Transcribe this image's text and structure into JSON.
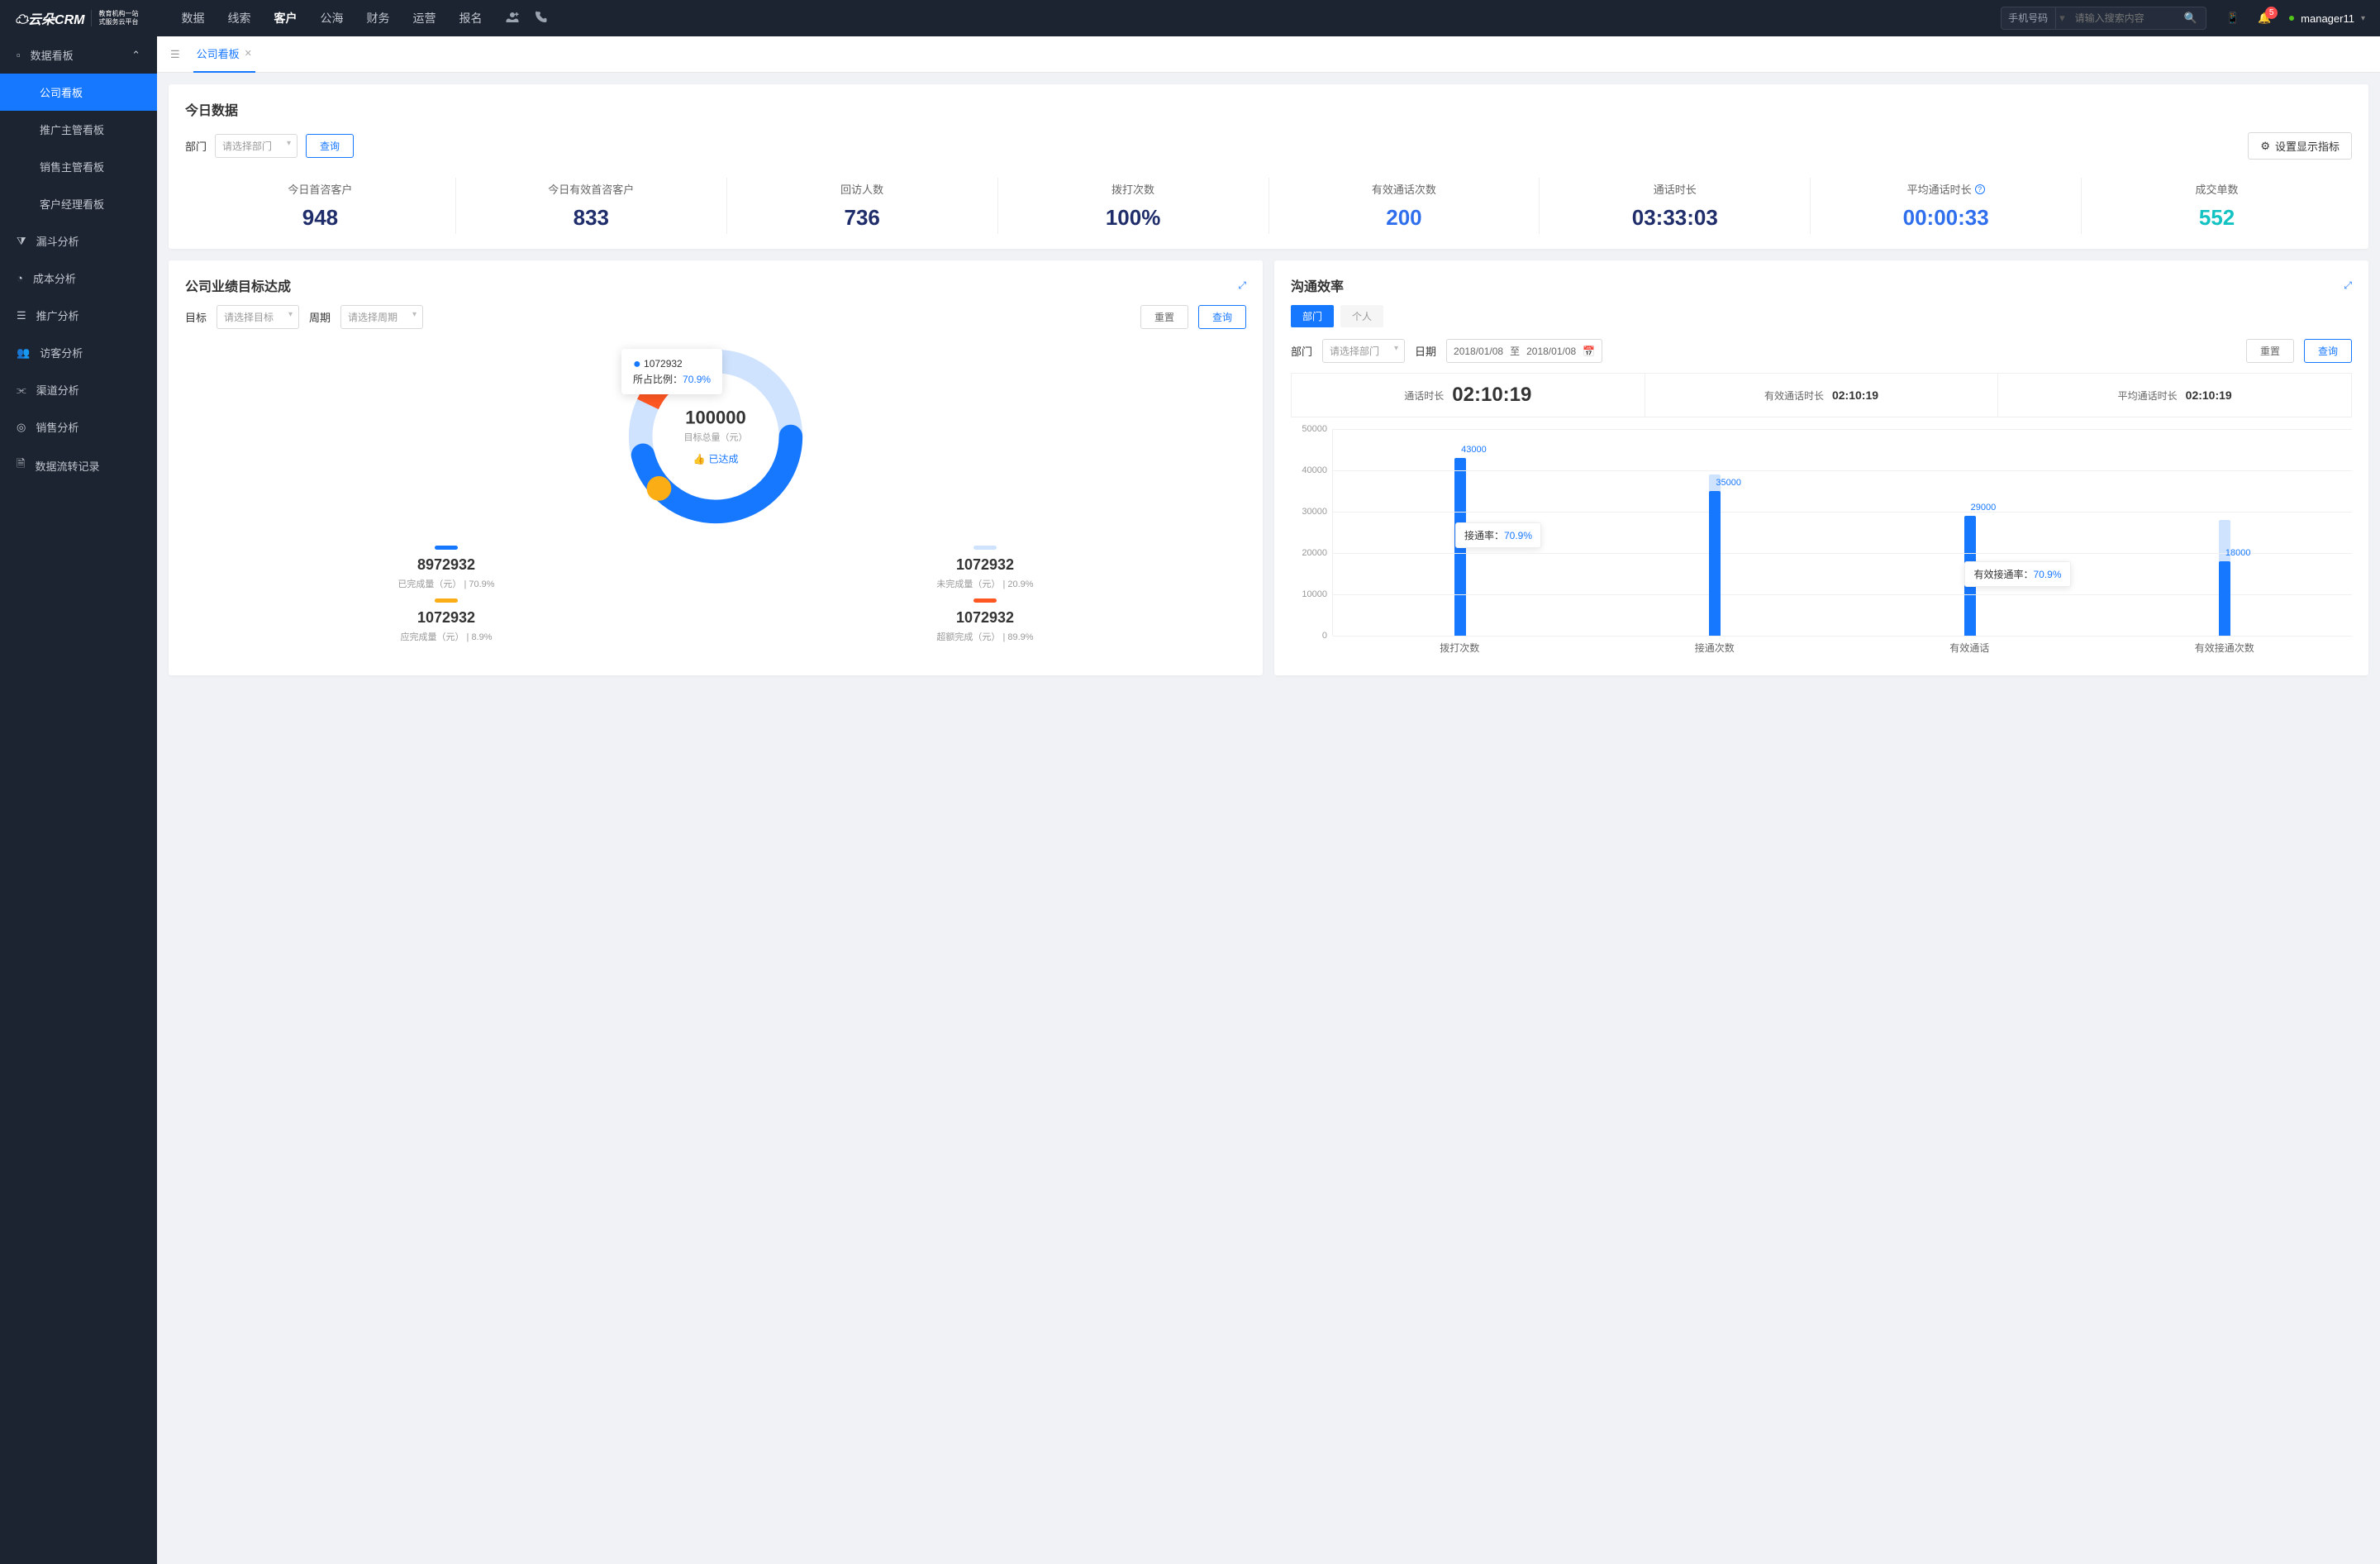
{
  "brand": {
    "name": "云朵CRM",
    "url": "www.yunduocrm.com",
    "tagline1": "教育机构一站",
    "tagline2": "式服务云平台"
  },
  "topnav": {
    "links": [
      "数据",
      "线索",
      "客户",
      "公海",
      "财务",
      "运营",
      "报名"
    ],
    "active": "客户",
    "search_type": "手机号码",
    "search_placeholder": "请输入搜索内容",
    "badge": "5",
    "user": "manager11"
  },
  "sidebar": {
    "group": {
      "label": "数据看板",
      "expanded": true
    },
    "subs": [
      "公司看板",
      "推广主管看板",
      "销售主管看板",
      "客户经理看板"
    ],
    "active_sub": "公司看板",
    "items": [
      "漏斗分析",
      "成本分析",
      "推广分析",
      "访客分析",
      "渠道分析",
      "销售分析",
      "数据流转记录"
    ]
  },
  "tabs": {
    "active": "公司看板"
  },
  "today": {
    "title": "今日数据",
    "dept_label": "部门",
    "dept_placeholder": "请选择部门",
    "query": "查询",
    "config": "设置显示指标",
    "metrics": [
      {
        "label": "今日首咨客户",
        "value": "948",
        "color": "navy"
      },
      {
        "label": "今日有效首咨客户",
        "value": "833",
        "color": "navy"
      },
      {
        "label": "回访人数",
        "value": "736",
        "color": "navy"
      },
      {
        "label": "拨打次数",
        "value": "100%",
        "color": "navy"
      },
      {
        "label": "有效通话次数",
        "value": "200",
        "color": "blue"
      },
      {
        "label": "通话时长",
        "value": "03:33:03",
        "color": "navy"
      },
      {
        "label": "平均通话时长",
        "value": "00:00:33",
        "color": "blue",
        "info": true
      },
      {
        "label": "成交单数",
        "value": "552",
        "color": "cyan"
      }
    ]
  },
  "goal": {
    "title": "公司业绩目标达成",
    "target_label": "目标",
    "target_placeholder": "请选择目标",
    "period_label": "周期",
    "period_placeholder": "请选择周期",
    "reset": "重置",
    "query": "查询",
    "center_value": "100000",
    "center_label": "目标总量（元）",
    "status": "已达成",
    "tooltip_value": "1072932",
    "tooltip_pct_label": "所占比例：",
    "tooltip_pct": "70.9%",
    "legend": [
      {
        "color": "#1677ff",
        "value": "8972932",
        "label": "已完成量（元）",
        "pct": "70.9%"
      },
      {
        "color": "#cfe3ff",
        "value": "1072932",
        "label": "未完成量（元）",
        "pct": "20.9%"
      },
      {
        "color": "#faad14",
        "value": "1072932",
        "label": "应完成量（元）",
        "pct": "8.9%"
      },
      {
        "color": "#ff5722",
        "value": "1072932",
        "label": "超额完成（元）",
        "pct": "89.9%"
      }
    ]
  },
  "comm": {
    "title": "沟通效率",
    "seg": [
      "部门",
      "个人"
    ],
    "seg_active": "部门",
    "dept_label": "部门",
    "dept_placeholder": "请选择部门",
    "date_label": "日期",
    "date_from": "2018/01/08",
    "date_to": "2018/01/08",
    "date_sep": "至",
    "reset": "重置",
    "query": "查询",
    "kpis": [
      {
        "label": "通话时长",
        "value": "02:10:19",
        "big": true
      },
      {
        "label": "有效通话时长",
        "value": "02:10:19"
      },
      {
        "label": "平均通话时长",
        "value": "02:10:19"
      }
    ],
    "notes": [
      {
        "label": "接通率：",
        "pct": "70.9%"
      },
      {
        "label": "有效接通率：",
        "pct": "70.9%"
      }
    ]
  },
  "chart_data": {
    "type": "bar",
    "categories": [
      "拨打次数",
      "接通次数",
      "有效通话",
      "有效接通次数"
    ],
    "series": [
      {
        "name": "main",
        "color": "#1677ff",
        "values": [
          43000,
          35000,
          29000,
          18000
        ]
      },
      {
        "name": "shadow",
        "color": "#cfe3ff",
        "values": [
          null,
          39000,
          null,
          28000
        ]
      }
    ],
    "ylim": [
      0,
      50000
    ],
    "yticks": [
      0,
      10000,
      20000,
      30000,
      40000,
      50000
    ]
  }
}
